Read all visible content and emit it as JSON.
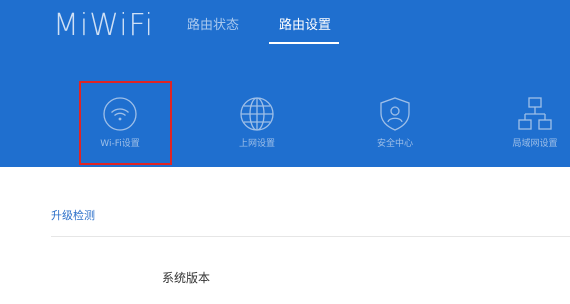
{
  "app": {
    "logo_text": "MiWiFi"
  },
  "tabs": [
    {
      "label": "路由状态",
      "active": false
    },
    {
      "label": "路由设置",
      "active": true
    }
  ],
  "nav": [
    {
      "label": "Wi-Fi设置",
      "icon": "wifi-icon",
      "selected": true
    },
    {
      "label": "上网设置",
      "icon": "globe-icon",
      "selected": false
    },
    {
      "label": "安全中心",
      "icon": "shield-user-icon",
      "selected": false
    },
    {
      "label": "局域网设置",
      "icon": "lan-network-icon",
      "selected": false
    }
  ],
  "content": {
    "section_title": "升级检测",
    "system_version_label": "系统版本"
  },
  "colors": {
    "header_bg": "#1f6fcf",
    "highlight_border": "#e02424",
    "section_title": "#2a6fc9"
  }
}
